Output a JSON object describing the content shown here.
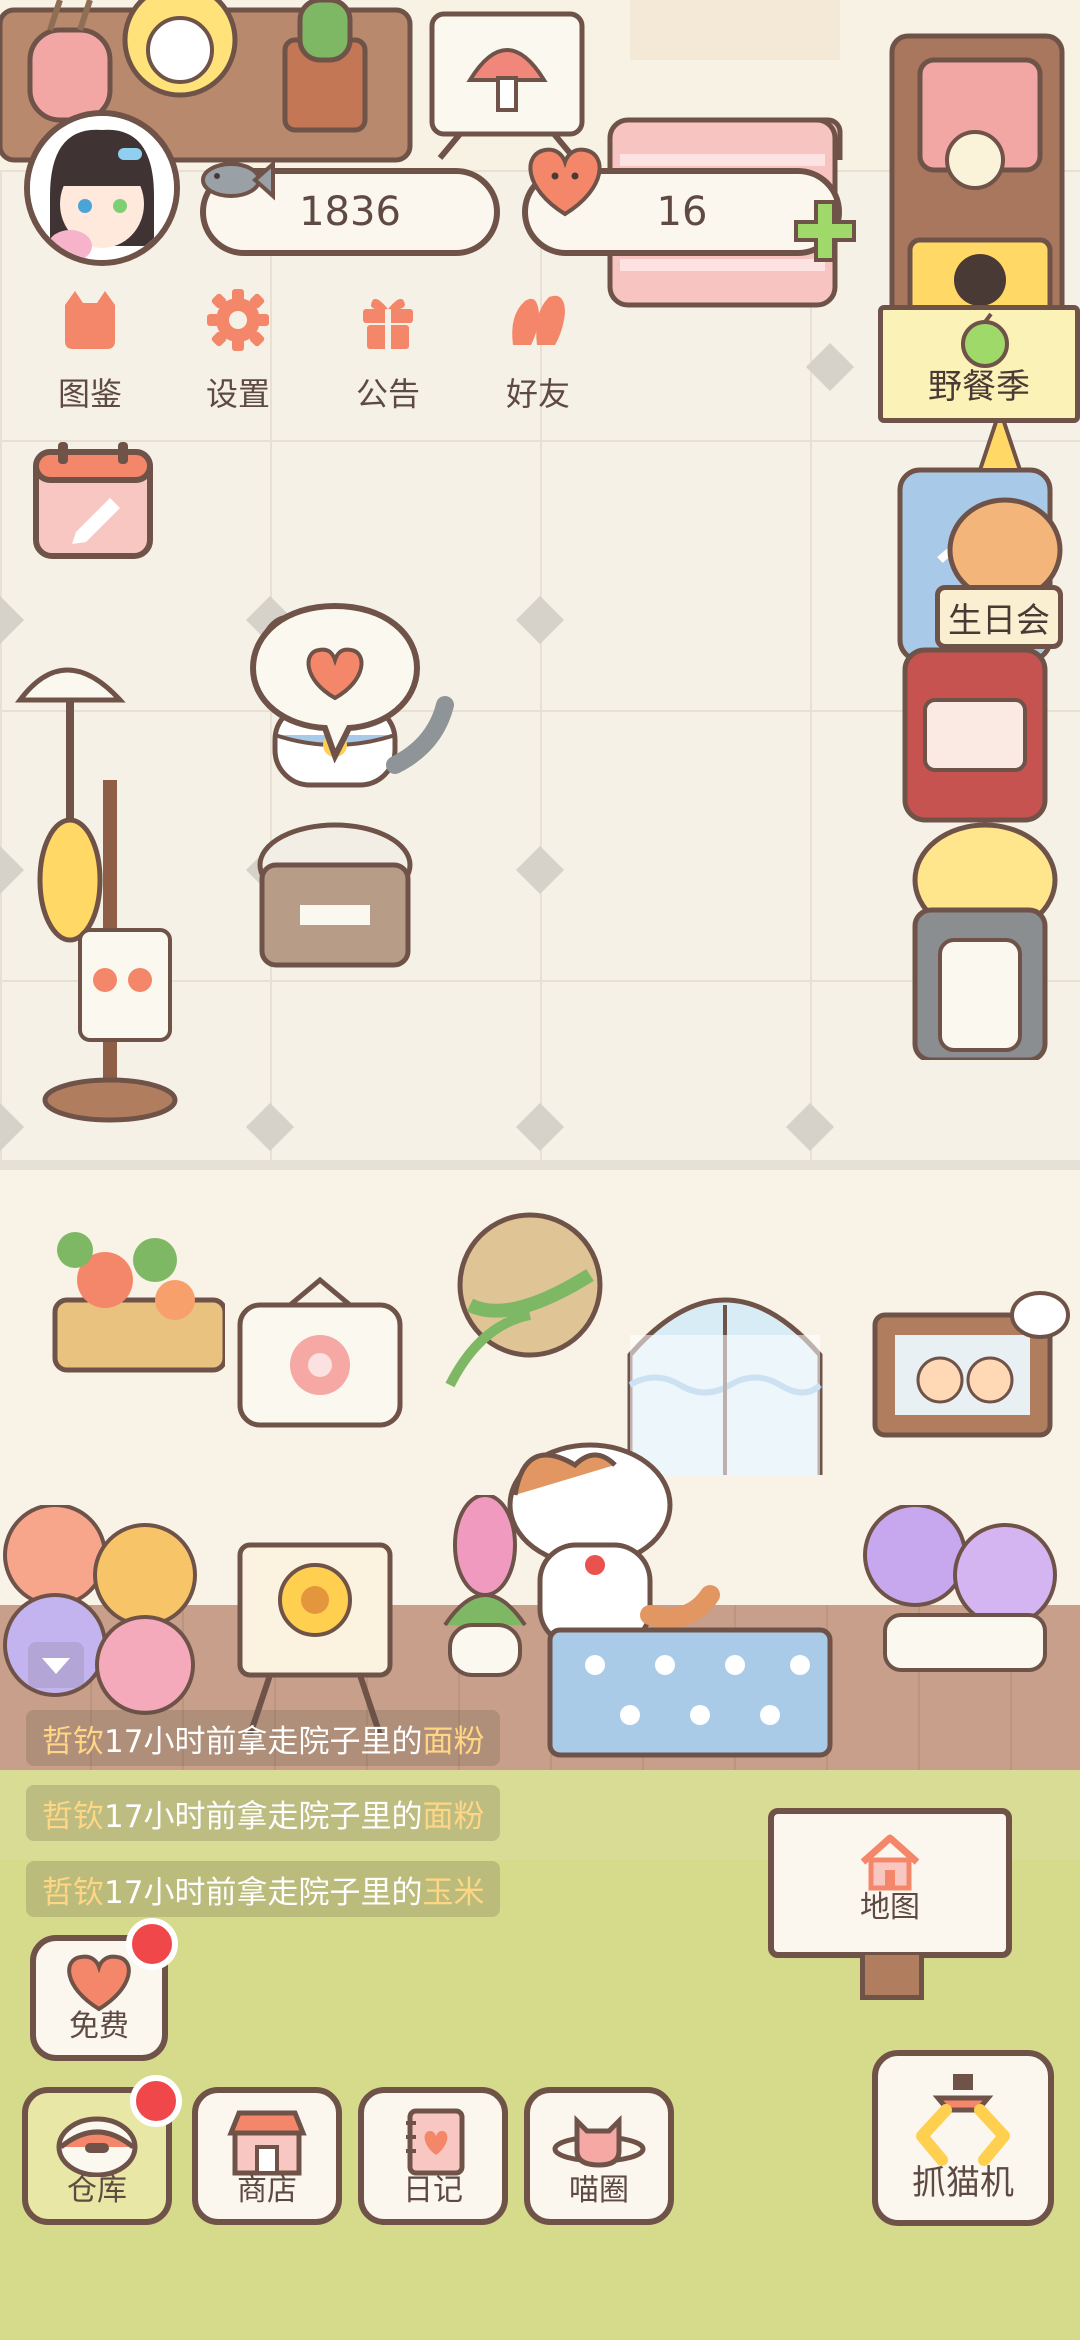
{
  "hud": {
    "fish_count": "1836",
    "heart_count": "16"
  },
  "top_menu": [
    {
      "label": "图鉴",
      "icon": "cat-book-icon"
    },
    {
      "label": "设置",
      "icon": "gear-icon"
    },
    {
      "label": "公告",
      "icon": "gift-icon"
    },
    {
      "label": "好友",
      "icon": "friends-icon"
    }
  ],
  "events": {
    "picnic": "野餐季",
    "birthday": "生日会"
  },
  "feed": [
    {
      "user": "哲钦",
      "text": "17小时前拿走院子里的",
      "item": "面粉"
    },
    {
      "user": "哲钦",
      "text": "17小时前拿走院子里的",
      "item": "面粉"
    },
    {
      "user": "哲钦",
      "text": "17小时前拿走院子里的",
      "item": "玉米"
    }
  ],
  "map_button": "地图",
  "free_button": "免费",
  "bottom_nav": [
    {
      "label": "仓库",
      "icon": "warehouse-icon"
    },
    {
      "label": "商店",
      "icon": "shop-icon"
    },
    {
      "label": "日记",
      "icon": "diary-icon"
    },
    {
      "label": "喵圈",
      "icon": "cat-planet-icon"
    }
  ],
  "claw_machine": "抓猫机",
  "colors": {
    "outline": "#6f5349",
    "accent": "#f4876a",
    "badge": "#f0474b",
    "grass": "#d9dc94",
    "highlight": "#ffd684"
  }
}
